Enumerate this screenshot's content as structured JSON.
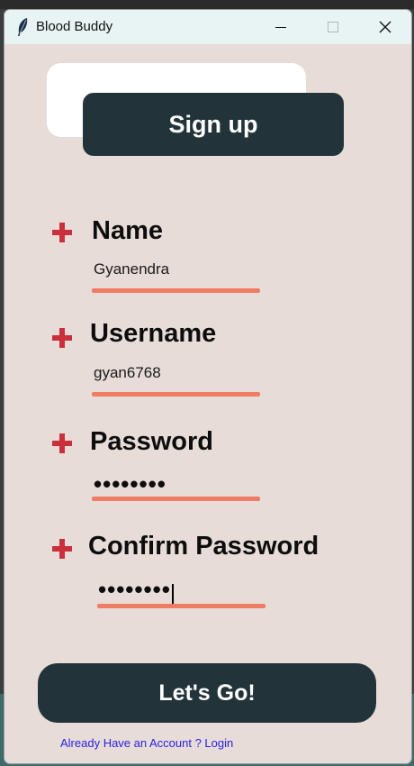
{
  "window": {
    "title": "Blood Buddy",
    "icon": "feather-icon"
  },
  "header": {
    "signup_label": "Sign up"
  },
  "fields": [
    {
      "label": "Name",
      "value": "Gyanendra"
    },
    {
      "label": "Username",
      "value": "gyan6768"
    },
    {
      "label": "Password",
      "value": "••••••••"
    },
    {
      "label": "Confirm Password",
      "value": "••••••••"
    }
  ],
  "actions": {
    "submit_label": "Let's Go!",
    "login_link": "Already Have an Account ? Login"
  },
  "colors": {
    "panel_background": "#e7dcd8",
    "button_dark": "#22333a",
    "required_marker": "#c9303c",
    "underline_accent": "#f2735a",
    "link_blue": "#2a22e0"
  }
}
